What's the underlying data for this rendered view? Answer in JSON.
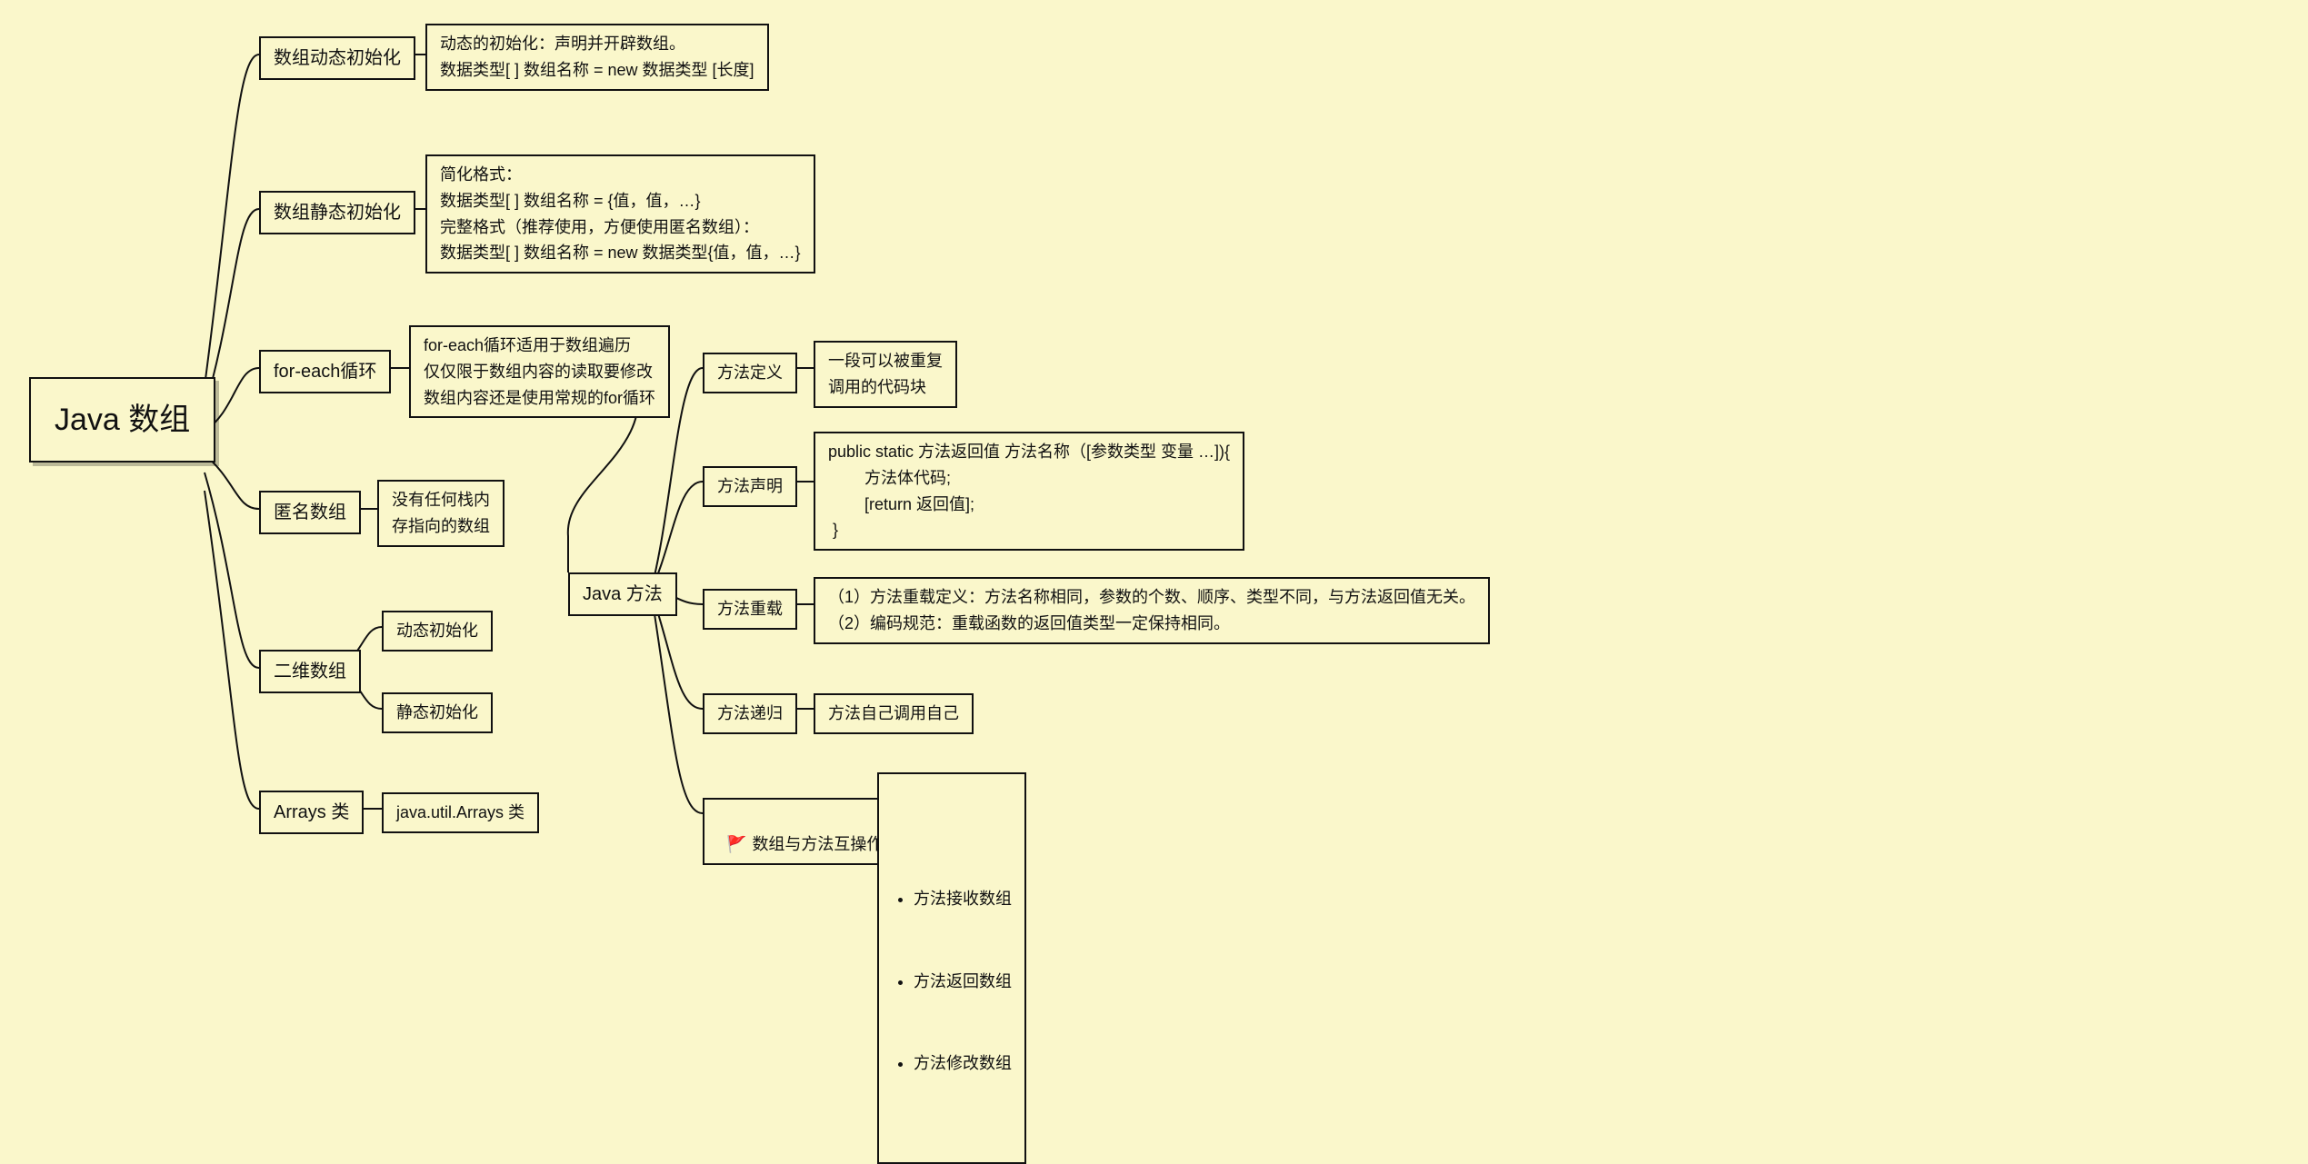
{
  "root": "Java 数组",
  "branch1": {
    "label": "数组动态初始化",
    "detail": "动态的初始化：声明并开辟数组。\n数据类型[ ] 数组名称 = new 数据类型 [长度]"
  },
  "branch2": {
    "label": "数组静态初始化",
    "detail": "简化格式：\n数据类型[ ] 数组名称 = {值，值，…}\n完整格式（推荐使用，方便使用匿名数组）：\n数据类型[ ] 数组名称 = new 数据类型{值，值，…}"
  },
  "branch3": {
    "label": "for-each循环",
    "detail": "for-each循环适用于数组遍历\n仅仅限于数组内容的读取要修改\n数组内容还是使用常规的for循环"
  },
  "branch4": {
    "label": "匿名数组",
    "detail": "没有任何栈内\n存指向的数组"
  },
  "branch5": {
    "label": "二维数组",
    "sub1": "动态初始化",
    "sub2": "静态初始化"
  },
  "branch6": {
    "label": "Arrays 类",
    "detail": "java.util.Arrays 类"
  },
  "javaMethod": {
    "label": "Java 方法",
    "m1": {
      "label": "方法定义",
      "detail": "一段可以被重复\n调用的代码块"
    },
    "m2": {
      "label": "方法声明",
      "detail": "public static 方法返回值 方法名称（[参数类型 变量 …]){\n        方法体代码;\n        [return 返回值];\n }"
    },
    "m3": {
      "label": "方法重载",
      "detail": "（1）方法重载定义：方法名称相同，参数的个数、顺序、类型不同，与方法返回值无关。\n（2）编码规范：重载函数的返回值类型一定保持相同。"
    },
    "m4": {
      "label": "方法递归",
      "detail": "方法自己调用自己"
    },
    "m5": {
      "label": "数组与方法互操作",
      "bullets": [
        "方法接收数组",
        "方法返回数组",
        "方法修改数组"
      ]
    }
  }
}
